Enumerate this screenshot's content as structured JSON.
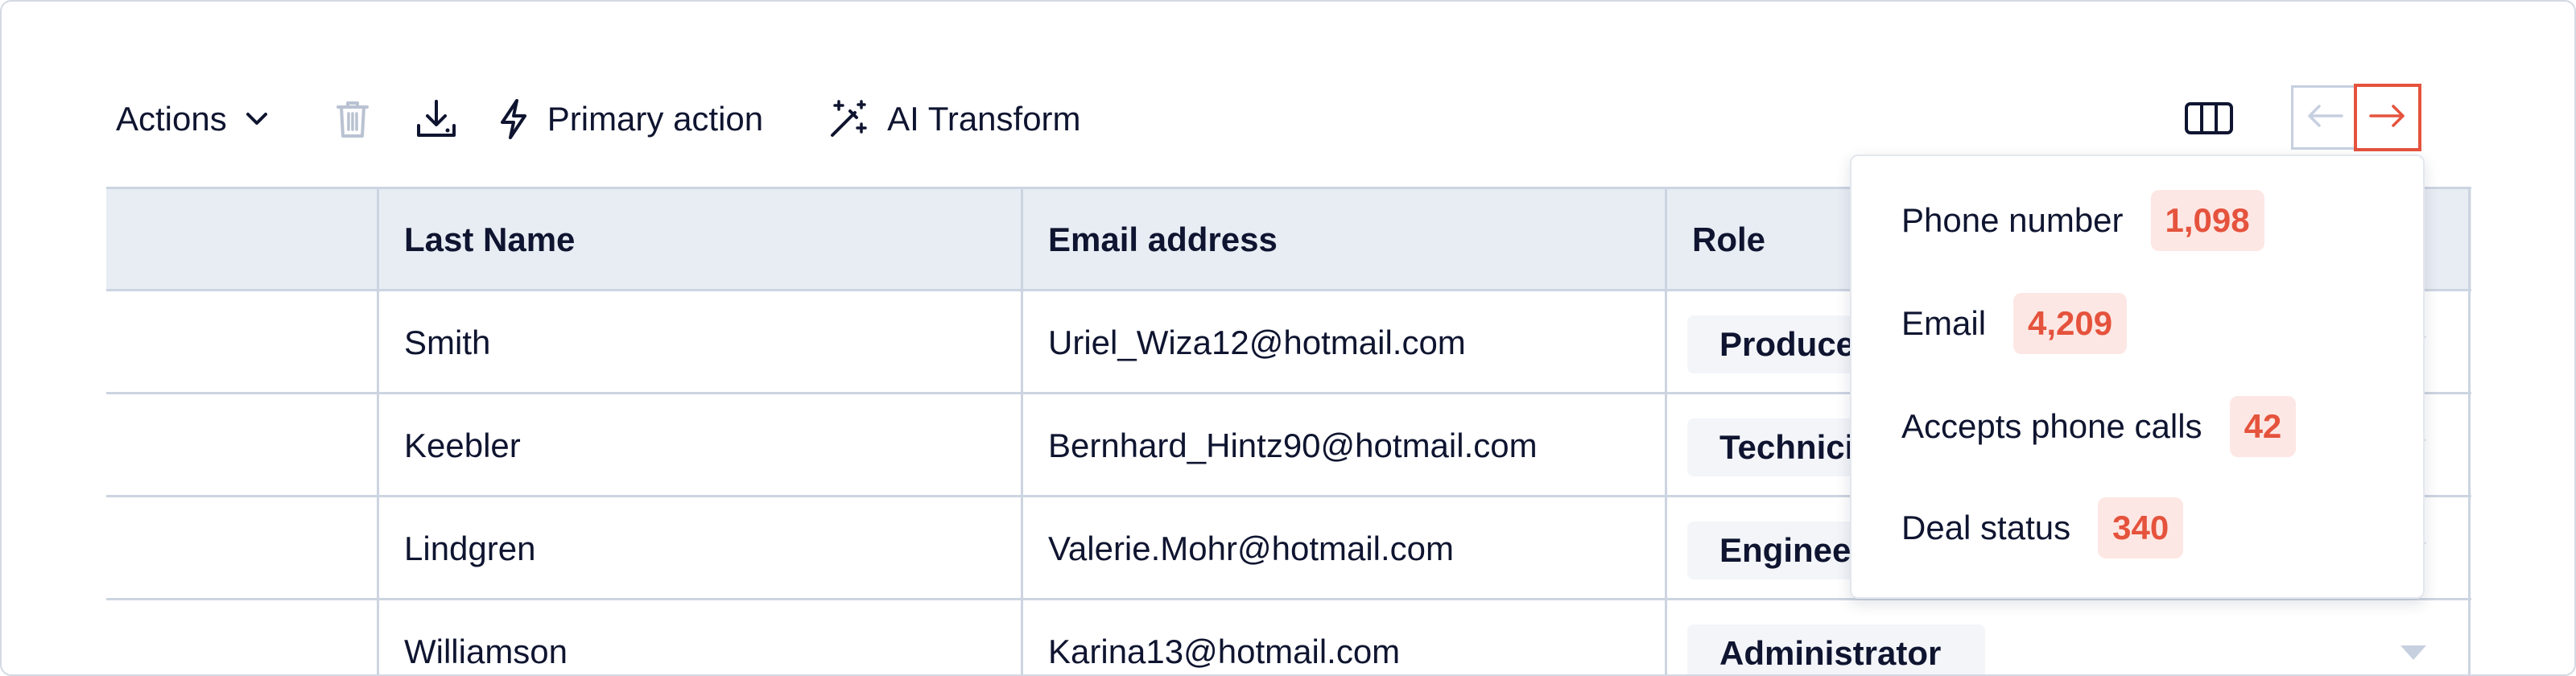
{
  "toolbar": {
    "actions_label": "Actions",
    "primary_action_label": "Primary action",
    "ai_transform_label": "AI Transform"
  },
  "table": {
    "headers": {
      "last_name": "Last Name",
      "email": "Email address",
      "role": "Role"
    },
    "rows": [
      {
        "last_name": "Smith",
        "email": "Uriel_Wiza12@hotmail.com",
        "role": "Producer"
      },
      {
        "last_name": "Keebler",
        "email": "Bernhard_Hintz90@hotmail.com",
        "role": "Technician"
      },
      {
        "last_name": "Lindgren",
        "email": "Valerie.Mohr@hotmail.com",
        "role": "Engineer"
      },
      {
        "last_name": "Williamson",
        "email": "Karina13@hotmail.com",
        "role": "Administrator"
      }
    ]
  },
  "popover": {
    "items": [
      {
        "label": "Phone number",
        "count": "1,098"
      },
      {
        "label": "Email",
        "count": "4,209"
      },
      {
        "label": "Accepts phone calls",
        "count": "42"
      },
      {
        "label": "Deal status",
        "count": "340"
      }
    ]
  },
  "colors": {
    "accent": "#e5533d",
    "header_bg": "#e8ecf3",
    "border": "#ccd4e1",
    "badge_bg": "#fde7e4"
  },
  "icons": [
    "chevron-down-icon",
    "trash-icon",
    "download-icon",
    "lightning-icon",
    "magic-wand-icon",
    "columns-icon",
    "arrow-left-icon",
    "arrow-right-icon",
    "caret-down-icon"
  ]
}
